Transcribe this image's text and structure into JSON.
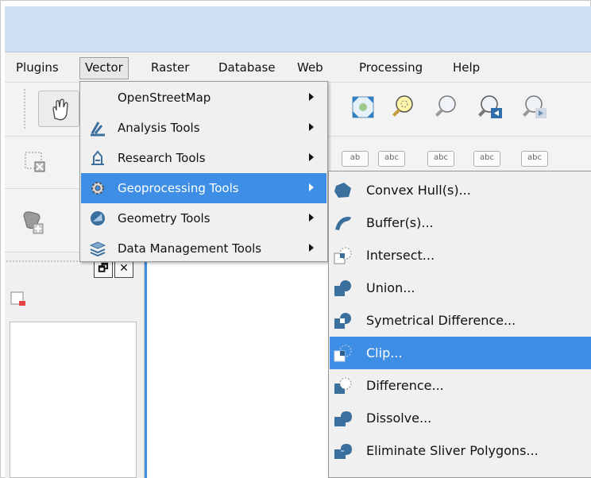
{
  "menubar": {
    "items": [
      {
        "label": "Plugins"
      },
      {
        "label": "Vector"
      },
      {
        "label": "Raster"
      },
      {
        "label": "Database"
      },
      {
        "label": "Web"
      },
      {
        "label": "Processing"
      },
      {
        "label": "Help"
      }
    ]
  },
  "vector_menu": {
    "items": [
      {
        "label": "OpenStreetMap",
        "icon": "none",
        "has_submenu": true
      },
      {
        "label": "Analysis Tools",
        "icon": "analysis-icon",
        "has_submenu": true
      },
      {
        "label": "Research Tools",
        "icon": "research-icon",
        "has_submenu": true
      },
      {
        "label": "Geoprocessing Tools",
        "icon": "gear-icon",
        "has_submenu": true,
        "highlighted": true
      },
      {
        "label": "Geometry Tools",
        "icon": "geometry-icon",
        "has_submenu": true
      },
      {
        "label": "Data Management Tools",
        "icon": "layers-icon",
        "has_submenu": true
      }
    ]
  },
  "geoprocessing_submenu": {
    "items": [
      {
        "label": "Convex Hull(s)...",
        "icon": "convex-hull-icon"
      },
      {
        "label": "Buffer(s)...",
        "icon": "buffer-icon"
      },
      {
        "label": "Intersect...",
        "icon": "intersect-icon"
      },
      {
        "label": "Union...",
        "icon": "union-icon"
      },
      {
        "label": "Symetrical Difference...",
        "icon": "symmetrical-difference-icon"
      },
      {
        "label": "Clip...",
        "icon": "clip-icon",
        "highlighted": true
      },
      {
        "label": "Difference...",
        "icon": "difference-icon"
      },
      {
        "label": "Dissolve...",
        "icon": "dissolve-icon"
      },
      {
        "label": "Eliminate Sliver Polygons...",
        "icon": "eliminate-icon"
      }
    ]
  },
  "label_toolbar": {
    "items": [
      "ab",
      "abc",
      "abc",
      "abc",
      "abc"
    ]
  },
  "panel": {
    "float_label": "🗗",
    "close_label": "✕"
  },
  "colors": {
    "highlight": "#3e8ee6",
    "titlebar": "#cfe0f3",
    "icon_blue": "#3b6f9e"
  }
}
